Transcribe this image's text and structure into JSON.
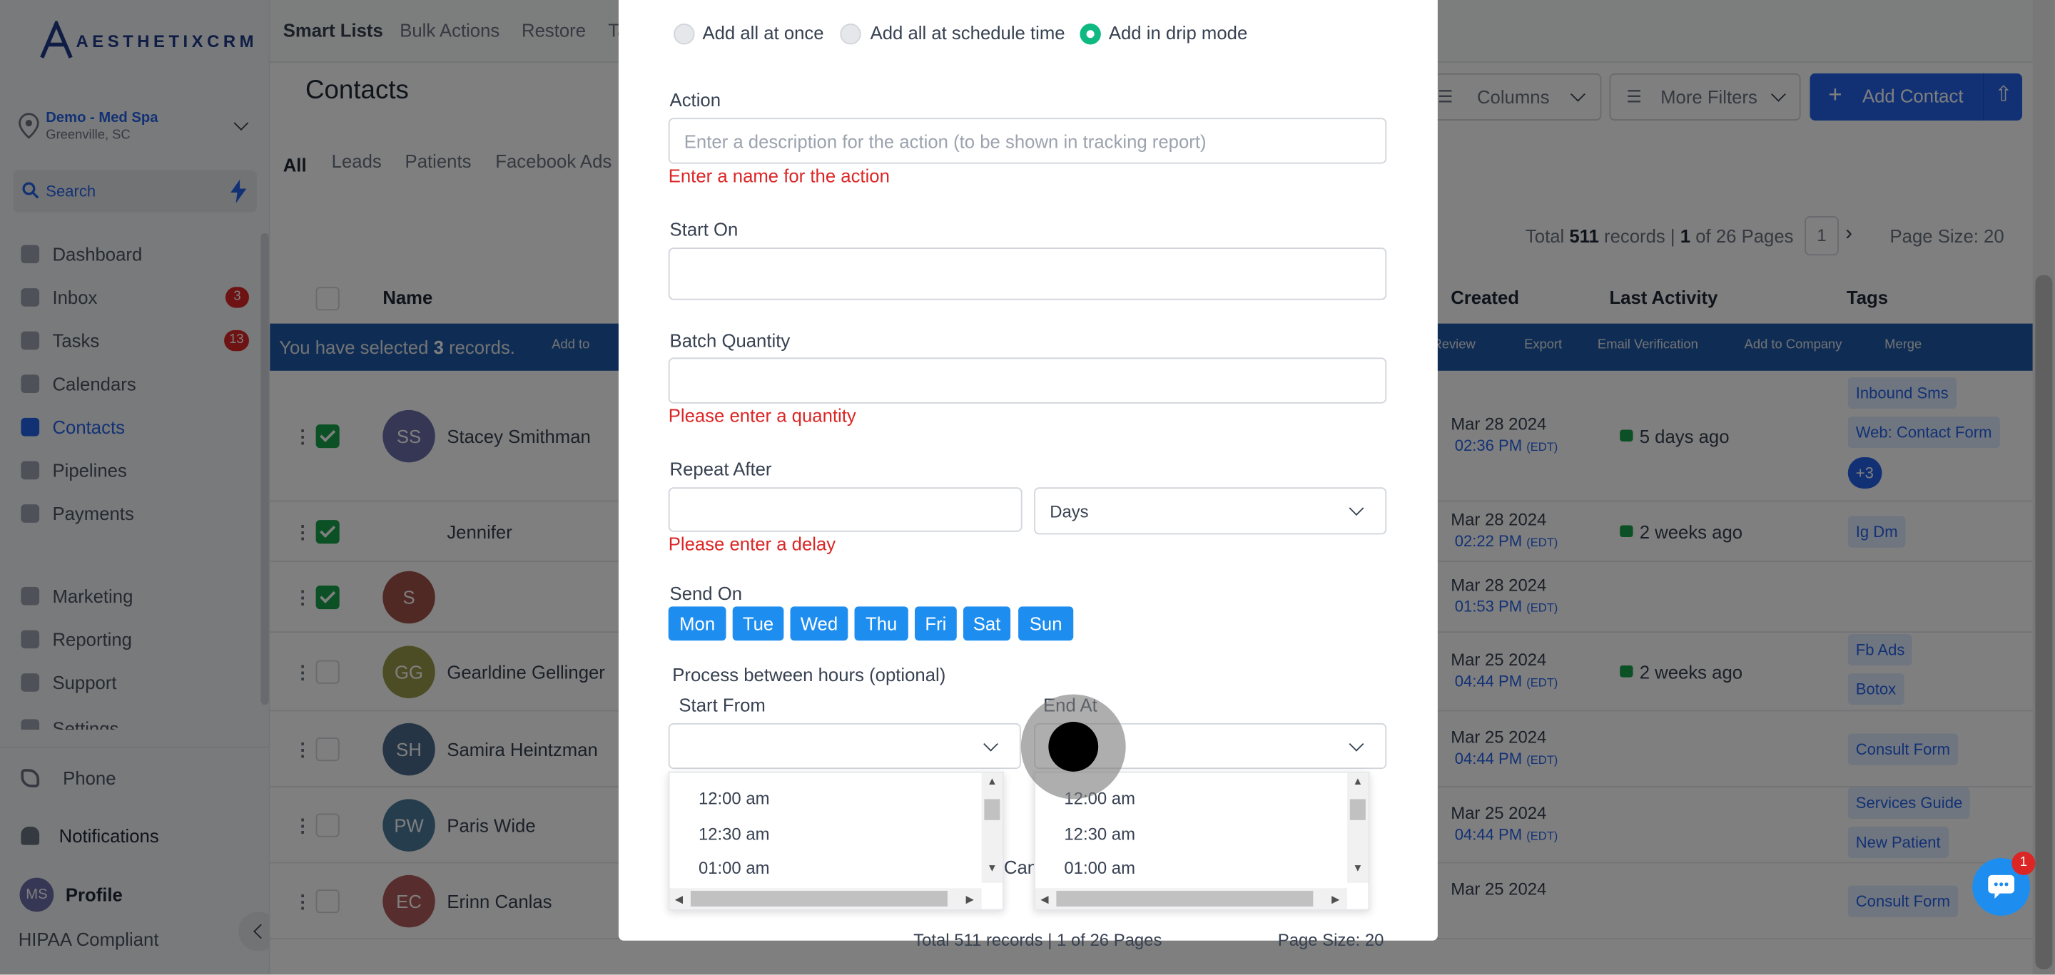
{
  "sidebar": {
    "brand": "AESTHETIXCRM",
    "location_name": "Demo - Med Spa",
    "location_city": "Greenville, SC",
    "search_label": "Search",
    "nav": [
      {
        "label": "Dashboard",
        "badge": ""
      },
      {
        "label": "Inbox",
        "badge": "3"
      },
      {
        "label": "Tasks",
        "badge": "13"
      },
      {
        "label": "Calendars",
        "badge": ""
      },
      {
        "label": "Contacts",
        "badge": ""
      },
      {
        "label": "Pipelines",
        "badge": ""
      },
      {
        "label": "Payments",
        "badge": ""
      },
      {
        "label": "Marketing",
        "badge": ""
      },
      {
        "label": "Reporting",
        "badge": ""
      },
      {
        "label": "Support",
        "badge": ""
      },
      {
        "label": "Settings",
        "badge": ""
      }
    ],
    "phone": "Phone",
    "notifications": "Notifications",
    "profile_initials": "MS",
    "profile": "Profile",
    "hipaa": "HIPAA Compliant"
  },
  "header": {
    "tabs": [
      "Smart Lists",
      "Bulk Actions",
      "Restore",
      "Ta"
    ],
    "title": "Contacts",
    "columns": "Columns",
    "more_filters": "More Filters",
    "add_contact": "Add Contact"
  },
  "list_tabs": [
    "All",
    "Leads",
    "Patients",
    "Facebook Ads"
  ],
  "pagination": {
    "total_prefix": "Total",
    "total": "511",
    "records_word": "records |",
    "page": "1",
    "of_pages": "of 26 Pages",
    "current": "1",
    "page_size": "Page Size: 20",
    "footer": "Total 511 records | 1 of 26 Pages",
    "footer_size": "Page Size: 20"
  },
  "table": {
    "headers": {
      "name": "Name",
      "created": "Created",
      "last_activity": "Last Activity",
      "tags": "Tags"
    },
    "selected_prefix": "You have selected",
    "selected_count": "3",
    "selected_suffix": "records.",
    "bulk_actions": [
      "Add to",
      "Review",
      "Export",
      "Email Verification",
      "Add to Company",
      "Merge"
    ],
    "rows": [
      {
        "initials": "SS",
        "name": "Stacey Smithman",
        "date": "Mar 28 2024",
        "time": "02:36 PM",
        "tz": "(EDT)",
        "activity": "5 days ago",
        "tags": [
          "Inbound Sms",
          "Web: Contact Form",
          "+3"
        ],
        "checked": true,
        "avatar": "#6b6fa8"
      },
      {
        "initials": "",
        "name": "Jennifer",
        "date": "Mar 28 2024",
        "time": "02:22 PM",
        "tz": "(EDT)",
        "activity": "2 weeks ago",
        "tags": [
          "Ig Dm"
        ],
        "checked": true,
        "avatar": "#ffffff"
      },
      {
        "initials": "S",
        "name": "",
        "date": "Mar 28 2024",
        "time": "01:53 PM",
        "tz": "(EDT)",
        "activity": "",
        "tags": [],
        "checked": true,
        "avatar": "#a0524a"
      },
      {
        "initials": "GG",
        "name": "Gearldine Gellinger",
        "date": "Mar 25 2024",
        "time": "04:44 PM",
        "tz": "(EDT)",
        "activity": "2 weeks ago",
        "tags": [
          "Fb Ads",
          "Botox"
        ],
        "checked": false,
        "avatar": "#9a9a4a"
      },
      {
        "initials": "SH",
        "name": "Samira Heintzman",
        "date": "Mar 25 2024",
        "time": "04:44 PM",
        "tz": "(EDT)",
        "activity": "",
        "tags": [
          "Consult Form"
        ],
        "checked": false,
        "avatar": "#4a6a8a"
      },
      {
        "initials": "PW",
        "name": "Paris Wide",
        "date": "Mar 25 2024",
        "time": "04:44 PM",
        "tz": "(EDT)",
        "activity": "",
        "tags": [
          "Services Guide",
          "New Patient"
        ],
        "checked": false,
        "avatar": "#4a7a9a"
      },
      {
        "initials": "EC",
        "name": "Erinn Canlas",
        "date": "Mar 25 2024",
        "time": "",
        "tz": "",
        "activity": "",
        "tags": [
          "Consult Form"
        ],
        "checked": false,
        "avatar": "#b05a5a"
      }
    ]
  },
  "modal": {
    "modes": [
      "Add all at once",
      "Add all at schedule time",
      "Add in drip mode"
    ],
    "action_label": "Action",
    "action_placeholder": "Enter a description for the action (to be shown in tracking report)",
    "action_error": "Enter a name for the action",
    "start_on_label": "Start On",
    "batch_label": "Batch Quantity",
    "batch_error": "Please enter a quantity",
    "repeat_label": "Repeat After",
    "repeat_unit": "Days",
    "repeat_error": "Please enter a delay",
    "send_on_label": "Send On",
    "days": [
      "Mon",
      "Tue",
      "Wed",
      "Thu",
      "Fri",
      "Sat",
      "Sun"
    ],
    "process_label": "Process between hours (optional)",
    "start_from_label": "Start From",
    "end_at_label": "End At",
    "time_options": [
      "12:00 am",
      "12:30 am",
      "01:00 am"
    ],
    "cancel_partial": "Can"
  },
  "chat_badge": "1"
}
